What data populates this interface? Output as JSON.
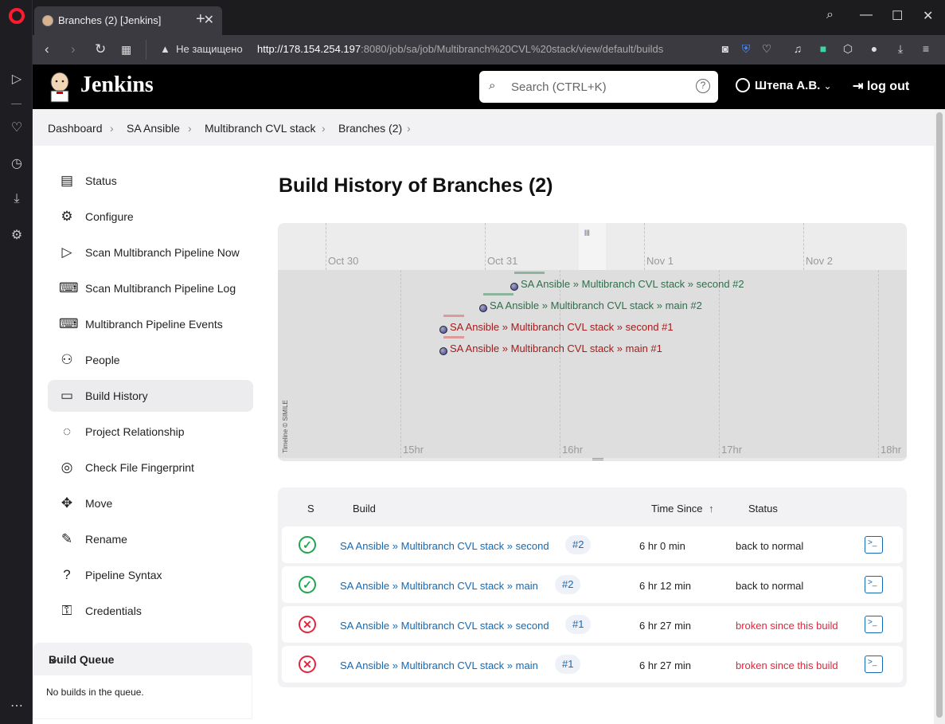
{
  "browser": {
    "tab_title": "Branches (2) [Jenkins]",
    "security_label": "Не защищено",
    "url_host": "http://178.154.254.197",
    "url_rest": ":8080/job/sa/job/Multibranch%20CVL%20stack/view/default/builds"
  },
  "header": {
    "app_name": "Jenkins",
    "search_placeholder": "Search (CTRL+K)",
    "search_help": "?",
    "user_name": "Штепа А.В.",
    "logout_label": "log out"
  },
  "breadcrumb": [
    "Dashboard",
    "SA Ansible",
    "Multibranch CVL stack",
    "Branches (2)"
  ],
  "sidebar": {
    "items": [
      {
        "label": "Status",
        "icon": "document-icon"
      },
      {
        "label": "Configure",
        "icon": "gear-icon"
      },
      {
        "label": "Scan Multibranch Pipeline Now",
        "icon": "play-icon"
      },
      {
        "label": "Scan Multibranch Pipeline Log",
        "icon": "terminal-icon"
      },
      {
        "label": "Multibranch Pipeline Events",
        "icon": "terminal-icon"
      },
      {
        "label": "People",
        "icon": "people-icon"
      },
      {
        "label": "Build History",
        "icon": "inbox-icon",
        "active": true
      },
      {
        "label": "Project Relationship",
        "icon": "relationship-icon"
      },
      {
        "label": "Check File Fingerprint",
        "icon": "fingerprint-icon"
      },
      {
        "label": "Move",
        "icon": "move-icon"
      },
      {
        "label": "Rename",
        "icon": "pencil-icon"
      },
      {
        "label": "Pipeline Syntax",
        "icon": "help-icon"
      },
      {
        "label": "Credentials",
        "icon": "key-icon"
      }
    ],
    "queue_title": "Build Queue",
    "queue_empty": "No builds in the queue."
  },
  "page_title": "Build History of Branches (2)",
  "timeline": {
    "dates": [
      "Oct 30",
      "Oct 31",
      "Nov 1",
      "Nov 2"
    ],
    "hours": [
      "15hr",
      "16hr",
      "17hr",
      "18hr"
    ],
    "credit": "Timeline © SIMILE",
    "events": [
      {
        "label": "SA Ansible » Multibranch CVL stack » second #2",
        "result": "success"
      },
      {
        "label": "SA Ansible » Multibranch CVL stack » main #2",
        "result": "success"
      },
      {
        "label": "SA Ansible » Multibranch CVL stack » second #1",
        "result": "failure"
      },
      {
        "label": "SA Ansible » Multibranch CVL stack » main #1",
        "result": "failure"
      }
    ],
    "colors": {
      "success": "#2f6e4b",
      "failure": "#a21d1d"
    }
  },
  "table": {
    "headers": {
      "s": "S",
      "build": "Build",
      "time_since": "Time Since",
      "sort_arrow": "↑",
      "status": "Status"
    },
    "rows": [
      {
        "build": "SA Ansible » Multibranch CVL stack » second",
        "number": "#2",
        "since": "6 hr 0 min",
        "status": "back to normal",
        "result": "success"
      },
      {
        "build": "SA Ansible » Multibranch CVL stack » main",
        "number": "#2",
        "since": "6 hr 12 min",
        "status": "back to normal",
        "result": "success"
      },
      {
        "build": "SA Ansible » Multibranch CVL stack » second",
        "number": "#1",
        "since": "6 hr 27 min",
        "status": "broken since this build",
        "result": "failure"
      },
      {
        "build": "SA Ansible » Multibranch CVL stack » main",
        "number": "#1",
        "since": "6 hr 27 min",
        "status": "broken since this build",
        "result": "failure"
      }
    ]
  }
}
